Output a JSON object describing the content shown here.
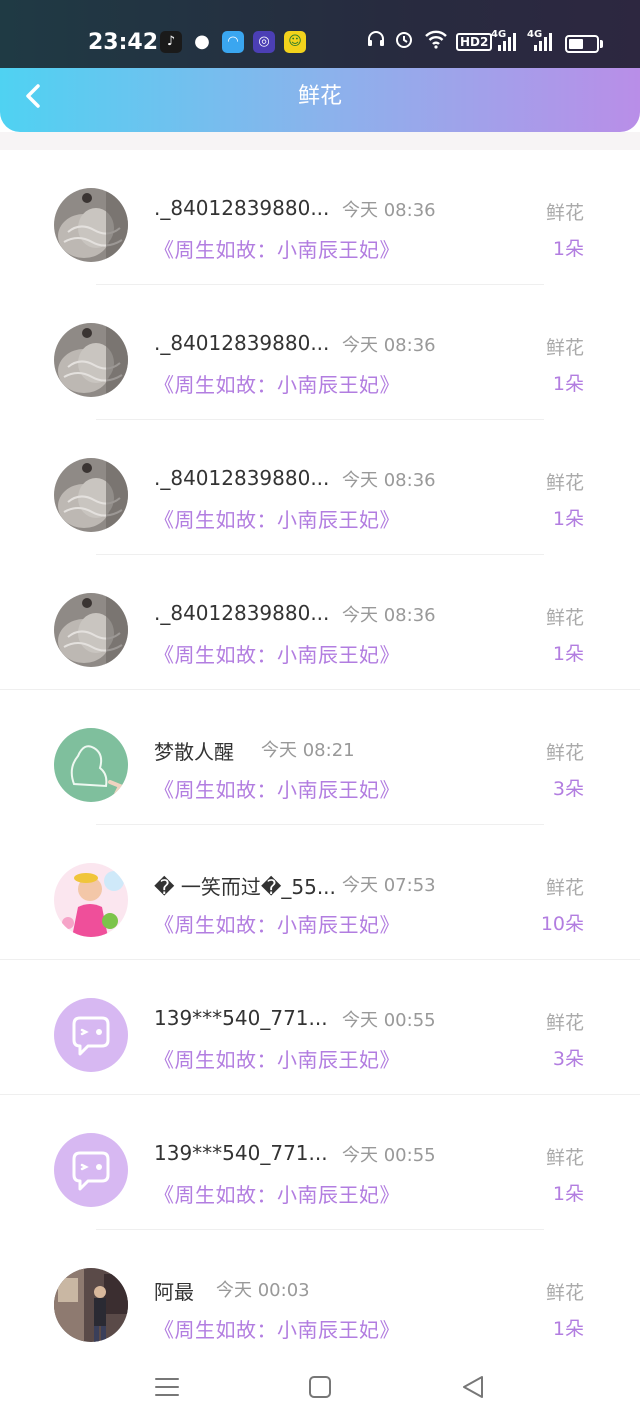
{
  "status_bar": {
    "time": "23:42",
    "apps": [
      "tiktok-icon",
      "wechat-icon",
      "cloud-app-icon",
      "circle-app-icon",
      "game-app-icon"
    ],
    "hd_label": "HD2",
    "net1": "4G",
    "net2": "4G"
  },
  "header": {
    "title": "鲜花"
  },
  "colors": {
    "header_gradient": [
      "#4fd2f2",
      "#b98ee8"
    ],
    "accent": "#b27de0",
    "muted": "#999999"
  },
  "items": [
    {
      "name": "._84012839880...",
      "time": "今天 08:36",
      "book": "《周生如故：小南辰王妃》",
      "gift": "鲜花",
      "count": "1朵",
      "avatar": "lace-photo"
    },
    {
      "name": "._84012839880...",
      "time": "今天 08:36",
      "book": "《周生如故：小南辰王妃》",
      "gift": "鲜花",
      "count": "1朵",
      "avatar": "lace-photo"
    },
    {
      "name": "._84012839880...",
      "time": "今天 08:36",
      "book": "《周生如故：小南辰王妃》",
      "gift": "鲜花",
      "count": "1朵",
      "avatar": "lace-photo"
    },
    {
      "name": "._84012839880...",
      "time": "今天 08:36",
      "book": "《周生如故：小南辰王妃》",
      "gift": "鲜花",
      "count": "1朵",
      "avatar": "lace-photo"
    },
    {
      "name": "梦散人醒",
      "time": "今天 08:21",
      "book": "《周生如故：小南辰王妃》",
      "gift": "鲜花",
      "count": "3朵",
      "avatar": "chalkboard-silhouette"
    },
    {
      "name": "� 一笑而过�_55...",
      "time": "今天 07:53",
      "book": "《周生如故：小南辰王妃》",
      "gift": "鲜花",
      "count": "10朵",
      "avatar": "child-photo"
    },
    {
      "name": "139***540_771...",
      "time": "今天 00:55",
      "book": "《周生如故：小南辰王妃》",
      "gift": "鲜花",
      "count": "3朵",
      "avatar": "default-chat"
    },
    {
      "name": "139***540_771...",
      "time": "今天 00:55",
      "book": "《周生如故：小南辰王妃》",
      "gift": "鲜花",
      "count": "1朵",
      "avatar": "default-chat"
    },
    {
      "name": "阿最",
      "time": "今天 00:03",
      "book": "《周生如故：小南辰王妃》",
      "gift": "鲜花",
      "count": "1朵",
      "avatar": "street-photo"
    }
  ],
  "nav": [
    "menu-icon",
    "home-square-icon",
    "back-triangle-icon"
  ]
}
